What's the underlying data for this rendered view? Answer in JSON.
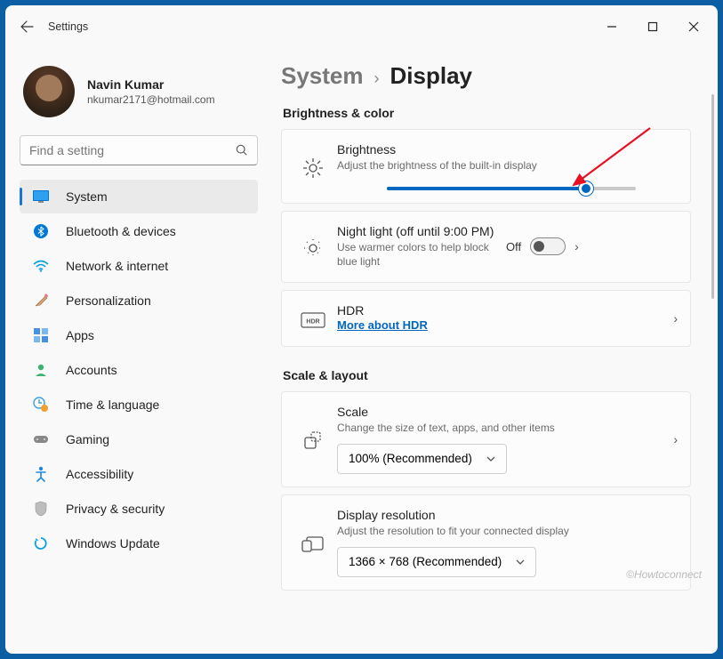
{
  "titlebar": {
    "title": "Settings"
  },
  "profile": {
    "name": "Navin Kumar",
    "email": "nkumar2171@hotmail.com"
  },
  "search": {
    "placeholder": "Find a setting"
  },
  "sidebar": {
    "items": [
      {
        "label": "System"
      },
      {
        "label": "Bluetooth & devices"
      },
      {
        "label": "Network & internet"
      },
      {
        "label": "Personalization"
      },
      {
        "label": "Apps"
      },
      {
        "label": "Accounts"
      },
      {
        "label": "Time & language"
      },
      {
        "label": "Gaming"
      },
      {
        "label": "Accessibility"
      },
      {
        "label": "Privacy & security"
      },
      {
        "label": "Windows Update"
      }
    ]
  },
  "breadcrumb": {
    "parent": "System",
    "current": "Display"
  },
  "sections": {
    "brightness_color": "Brightness & color",
    "scale_layout": "Scale & layout"
  },
  "cards": {
    "brightness": {
      "title": "Brightness",
      "desc": "Adjust the brightness of the built-in display",
      "value_percent": 80
    },
    "night_light": {
      "title": "Night light (off until 9:00 PM)",
      "desc": "Use warmer colors to help block blue light",
      "toggle_label": "Off",
      "toggle_on": false
    },
    "hdr": {
      "title": "HDR",
      "link": "More about HDR"
    },
    "scale": {
      "title": "Scale",
      "desc": "Change the size of text, apps, and other items",
      "value": "100% (Recommended)"
    },
    "resolution": {
      "title": "Display resolution",
      "desc": "Adjust the resolution to fit your connected display",
      "value": "1366 × 768 (Recommended)"
    }
  },
  "watermark": "©Howtoconnect"
}
